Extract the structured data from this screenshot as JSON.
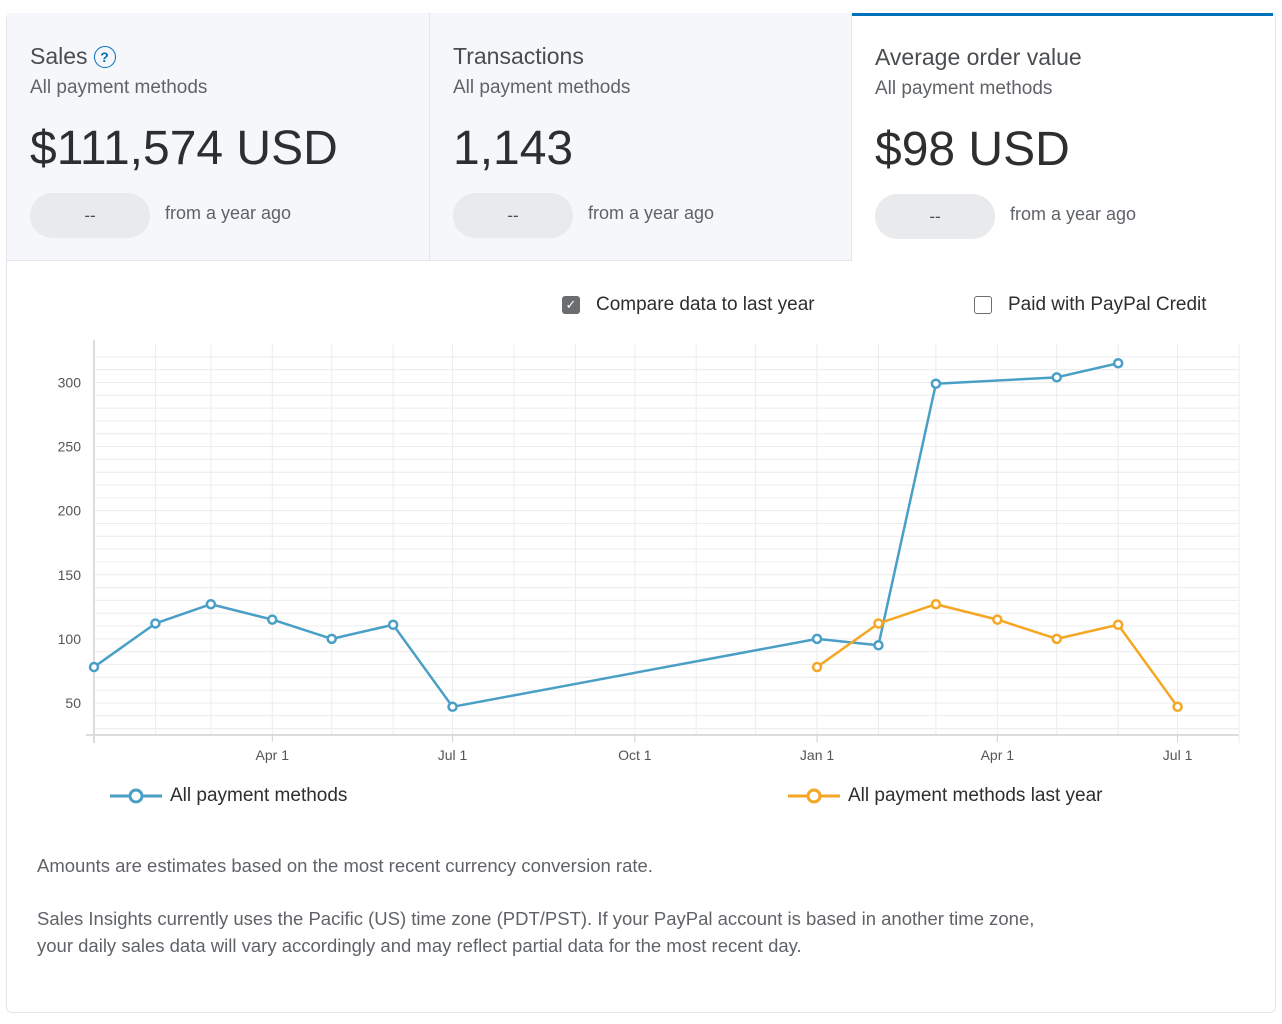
{
  "tiles": [
    {
      "title": "Sales",
      "subtitle": "All payment methods",
      "value": "$111,574 USD",
      "change": "--",
      "note": "from a year ago"
    },
    {
      "title": "Transactions",
      "subtitle": "All payment methods",
      "value": "1,143",
      "change": "--",
      "note": "from a year ago"
    },
    {
      "title": "Average order value",
      "subtitle": "All payment methods",
      "value": "$98 USD",
      "change": "--",
      "note": "from a year ago"
    }
  ],
  "help_icon_label": "?",
  "options": {
    "compare_label": "Compare data to last year",
    "compare_checked": true,
    "paypal_credit_label": "Paid with PayPal Credit",
    "paypal_credit_checked": false
  },
  "legend": {
    "current": "All payment methods",
    "last_year": "All payment methods last year"
  },
  "colors": {
    "current": "#4a9fc7",
    "last_year": "#f5a623",
    "accent": "#0070ba"
  },
  "chart_data": {
    "type": "line",
    "title": "",
    "xlabel": "",
    "ylabel": "",
    "ylim": [
      25,
      330
    ],
    "yticks": [
      50,
      100,
      150,
      200,
      250,
      300
    ],
    "grid": true,
    "legend_position": "bottom",
    "xticks": [
      {
        "label": "Apr 1",
        "date": "2019-04-01"
      },
      {
        "label": "Jul 1",
        "date": "2019-07-01"
      },
      {
        "label": "Oct 1",
        "date": "2019-10-01"
      },
      {
        "label": "Jan 1",
        "date": "2020-01-01"
      },
      {
        "label": "Apr 1",
        "date": "2020-04-01"
      },
      {
        "label": "Jul 1",
        "date": "2020-07-01"
      }
    ],
    "xlim": [
      "2019-01-01",
      "2020-08-01"
    ],
    "series": [
      {
        "name": "All payment methods",
        "points": [
          {
            "x": "2019-01-01",
            "y": 78
          },
          {
            "x": "2019-02-01",
            "y": 112
          },
          {
            "x": "2019-03-01",
            "y": 127
          },
          {
            "x": "2019-04-01",
            "y": 115
          },
          {
            "x": "2019-05-01",
            "y": 100
          },
          {
            "x": "2019-06-01",
            "y": 111
          },
          {
            "x": "2019-07-01",
            "y": 47
          },
          {
            "x": "2020-01-01",
            "y": 100
          },
          {
            "x": "2020-02-01",
            "y": 95
          },
          {
            "x": "2020-03-01",
            "y": 299
          },
          {
            "x": "2020-05-01",
            "y": 304
          },
          {
            "x": "2020-06-01",
            "y": 315
          }
        ]
      },
      {
        "name": "All payment methods last year",
        "points": [
          {
            "x": "2020-01-01",
            "y": 78
          },
          {
            "x": "2020-02-01",
            "y": 112
          },
          {
            "x": "2020-03-01",
            "y": 127
          },
          {
            "x": "2020-04-01",
            "y": 115
          },
          {
            "x": "2020-05-01",
            "y": 100
          },
          {
            "x": "2020-06-01",
            "y": 111
          },
          {
            "x": "2020-07-01",
            "y": 47
          }
        ]
      }
    ]
  },
  "notes": {
    "currency": "Amounts are estimates based on the most recent currency conversion rate.",
    "timezone_line1": "Sales Insights currently uses the Pacific (US) time zone (PDT/PST). If your PayPal account is based in another time zone,",
    "timezone_line2": "your daily sales data will vary accordingly and may reflect partial data for the most recent day."
  }
}
